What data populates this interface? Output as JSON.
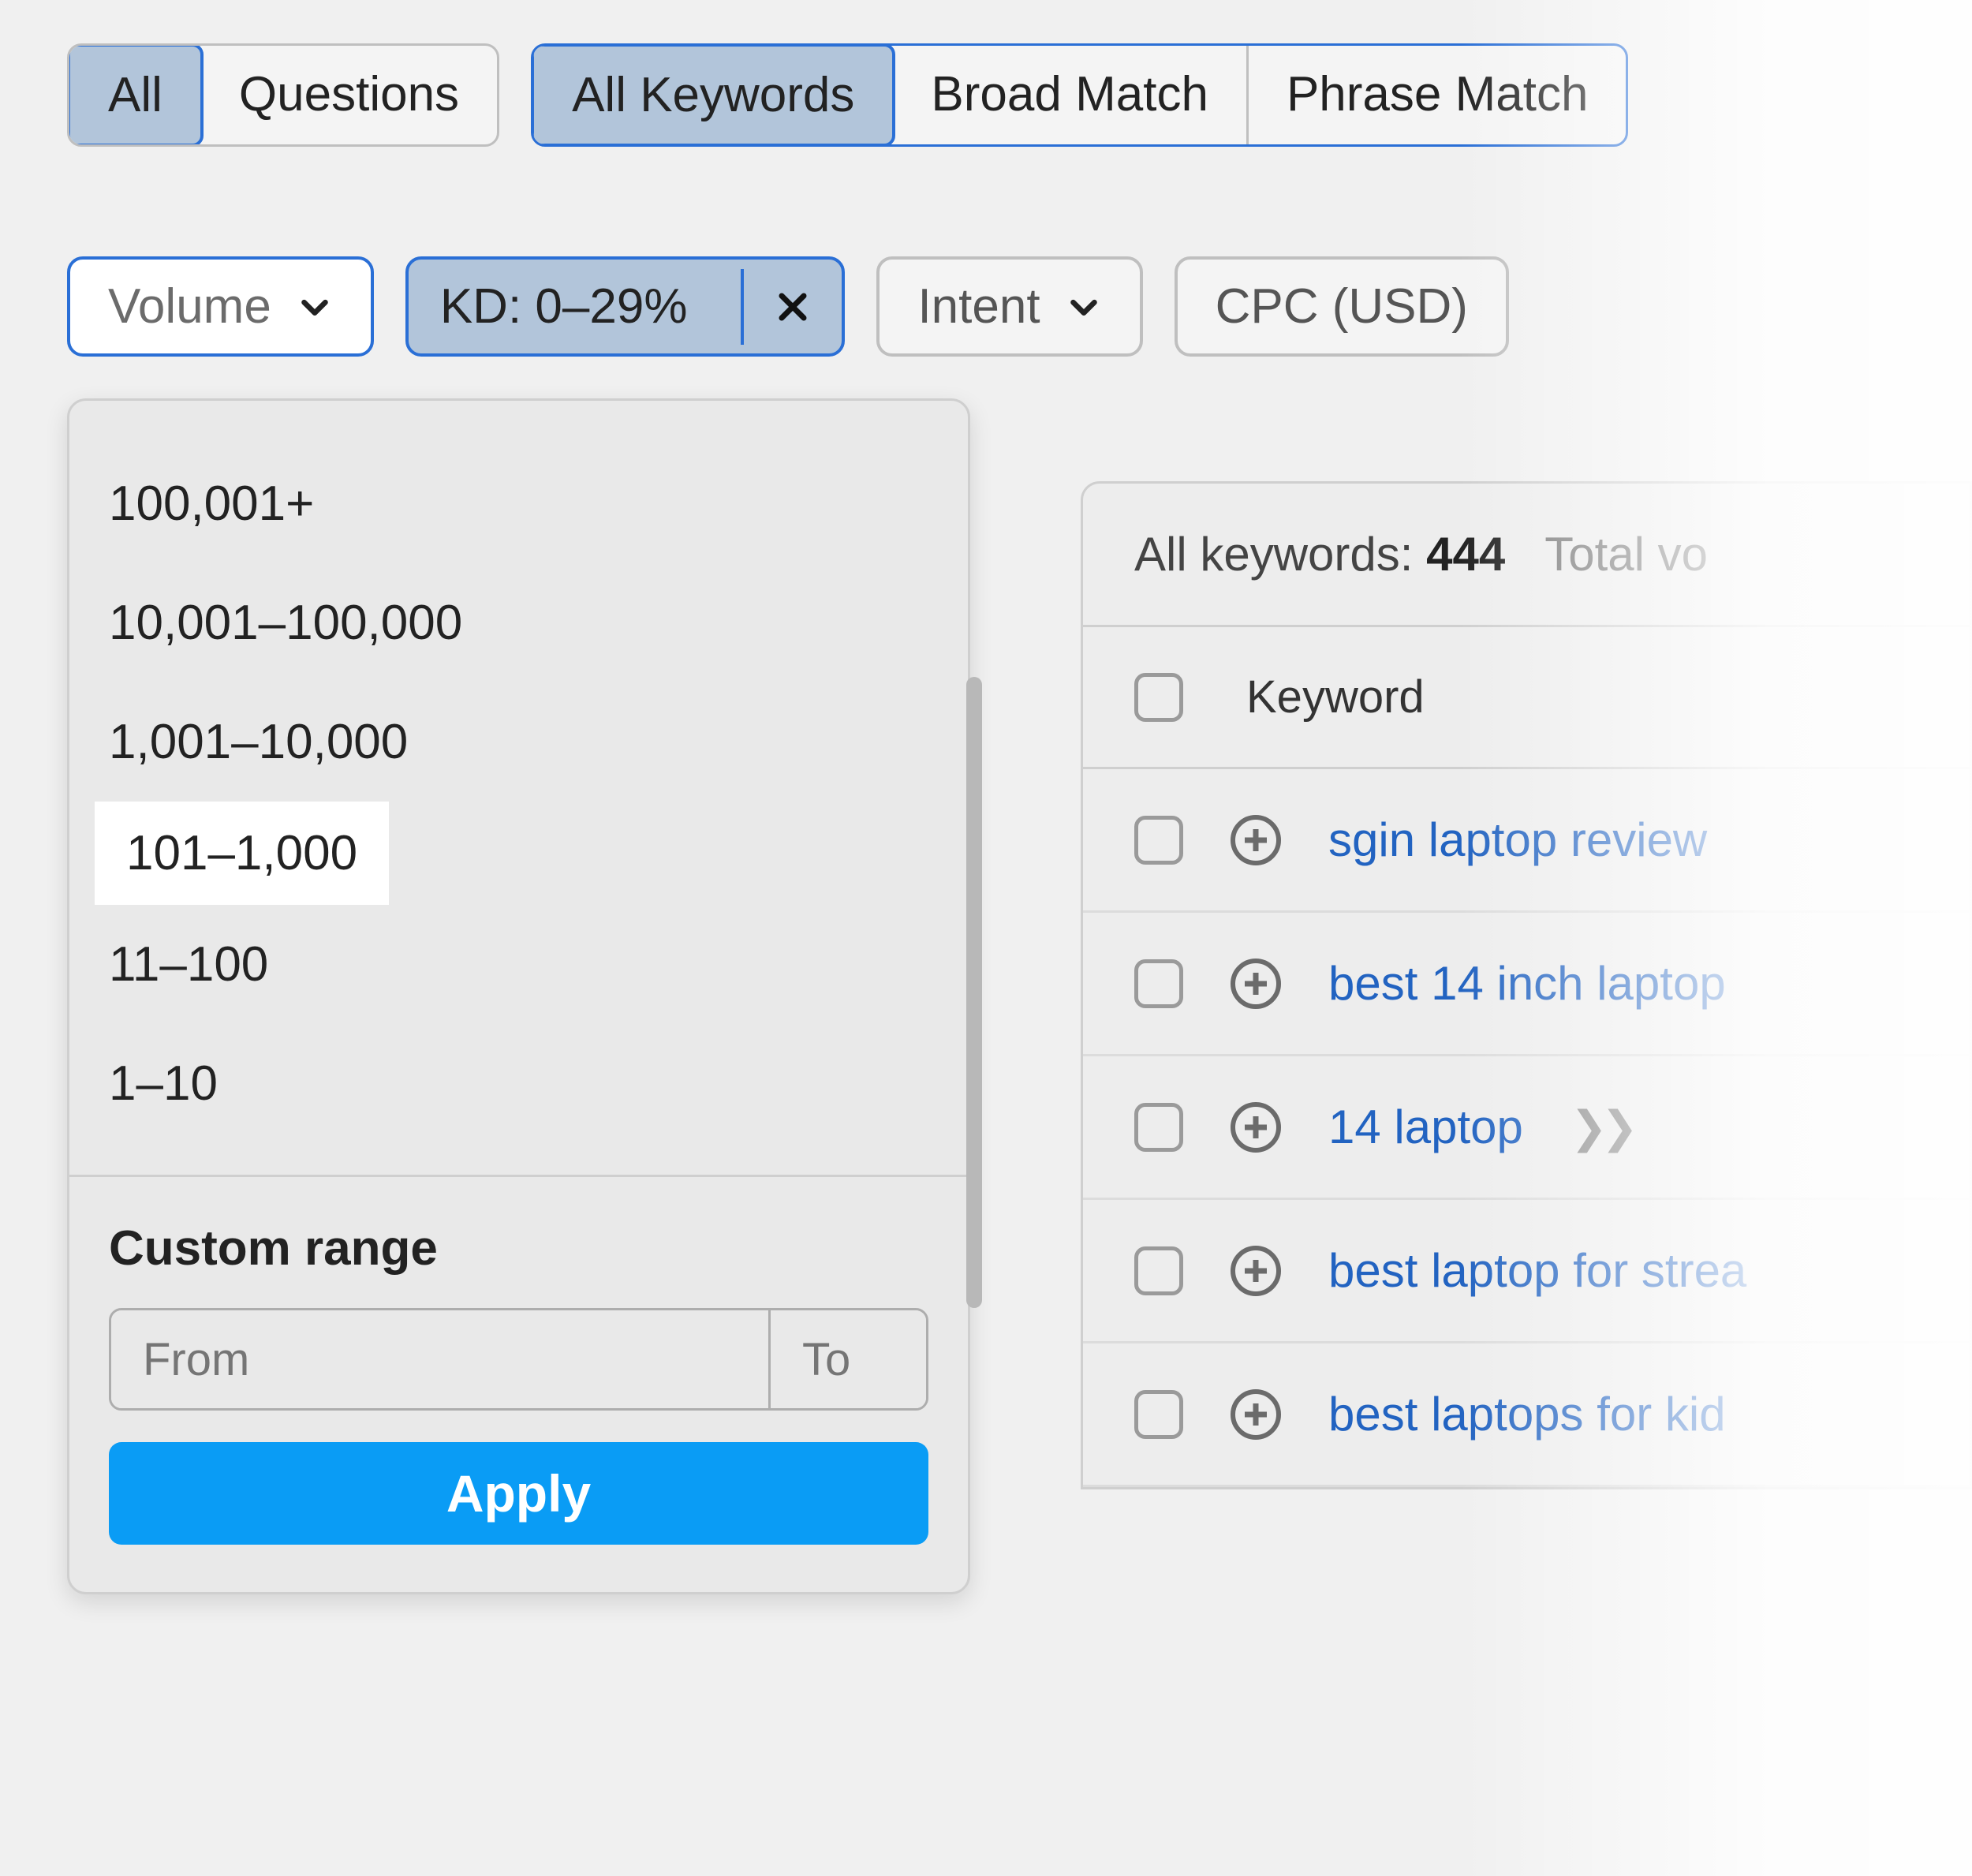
{
  "tabs": {
    "group1": [
      {
        "label": "All",
        "active": true
      },
      {
        "label": "Questions",
        "active": false
      }
    ],
    "group2": [
      {
        "label": "All Keywords",
        "active": true
      },
      {
        "label": "Broad Match",
        "active": false
      },
      {
        "label": "Phrase Match",
        "active": false
      }
    ]
  },
  "filters": {
    "volume_label": "Volume",
    "kd_label": "KD: 0–29%",
    "intent_label": "Intent",
    "cpc_label": "CPC (USD)"
  },
  "volume_dropdown": {
    "options": [
      "100,001+",
      "10,001–100,000",
      "1,001–10,000",
      "101–1,000",
      "11–100",
      "1–10"
    ],
    "highlighted_index": 3,
    "custom_title": "Custom range",
    "from_placeholder": "From",
    "to_placeholder": "To",
    "apply_label": "Apply"
  },
  "results": {
    "header_prefix": "All keywords: ",
    "count": "444",
    "total_label": "Total vo",
    "column_header": "Keyword",
    "rows": [
      {
        "text": "sgin laptop review",
        "more": false
      },
      {
        "text": "best 14 inch laptop",
        "more": false
      },
      {
        "text": "14 laptop",
        "more": true
      },
      {
        "text": "best laptop for strea",
        "more": false
      },
      {
        "text": "best laptops for kid",
        "more": false
      }
    ]
  }
}
